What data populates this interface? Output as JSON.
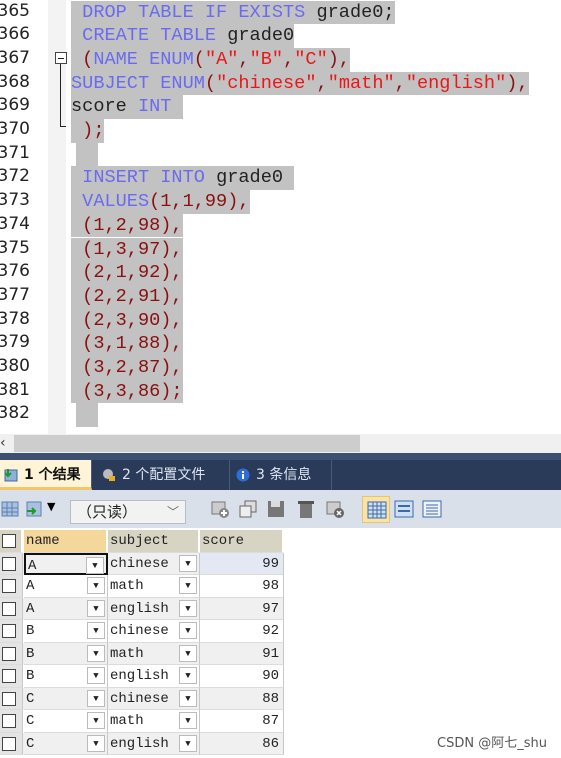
{
  "editor": {
    "line_numbers": [
      "365",
      "366",
      "367",
      "368",
      "369",
      "370",
      "371",
      "372",
      "373",
      "374",
      "375",
      "376",
      "377",
      "378",
      "379",
      "380",
      "381",
      "382"
    ],
    "lines": [
      [
        {
          "t": " DROP TABLE IF EXISTS ",
          "c": "kw"
        },
        {
          "t": "grade0;",
          "c": "id"
        }
      ],
      [
        {
          "t": " CREATE TABLE ",
          "c": "kw"
        },
        {
          "t": "grade0",
          "c": "id"
        }
      ],
      [
        {
          "t": " (",
          "c": "pu"
        },
        {
          "t": "NAME ENUM",
          "c": "kw"
        },
        {
          "t": "(",
          "c": "pu"
        },
        {
          "t": "\"A\"",
          "c": "st"
        },
        {
          "t": ",",
          "c": "pu"
        },
        {
          "t": "\"B\"",
          "c": "st"
        },
        {
          "t": ",",
          "c": "pu"
        },
        {
          "t": "\"C\"",
          "c": "st"
        },
        {
          "t": "),",
          "c": "pu"
        }
      ],
      [
        {
          "t": "SUBJECT ENUM",
          "c": "kw"
        },
        {
          "t": "(",
          "c": "pu"
        },
        {
          "t": "\"chinese\"",
          "c": "st"
        },
        {
          "t": ",",
          "c": "pu"
        },
        {
          "t": "\"math\"",
          "c": "st"
        },
        {
          "t": ",",
          "c": "pu"
        },
        {
          "t": "\"english\"",
          "c": "st"
        },
        {
          "t": "),",
          "c": "pu"
        }
      ],
      [
        {
          "t": "score ",
          "c": "id"
        },
        {
          "t": "INT ",
          "c": "kw"
        }
      ],
      [
        {
          "t": " );",
          "c": "pu"
        }
      ],
      [
        {
          "t": "  ",
          "c": "id"
        }
      ],
      [
        {
          "t": " INSERT INTO ",
          "c": "kw"
        },
        {
          "t": "grade0 ",
          "c": "id"
        }
      ],
      [
        {
          "t": " VALUES",
          "c": "kw"
        },
        {
          "t": "(1,1,99),",
          "c": "pu"
        }
      ],
      [
        {
          "t": " (1,2,98),",
          "c": "pu"
        }
      ],
      [
        {
          "t": " (1,3,97),",
          "c": "pu"
        }
      ],
      [
        {
          "t": " (2,1,92),",
          "c": "pu"
        }
      ],
      [
        {
          "t": " (2,2,91),",
          "c": "pu"
        }
      ],
      [
        {
          "t": " (2,3,90),",
          "c": "pu"
        }
      ],
      [
        {
          "t": " (3,1,88),",
          "c": "pu"
        }
      ],
      [
        {
          "t": " (3,2,87),",
          "c": "pu"
        }
      ],
      [
        {
          "t": " (3,3,86);",
          "c": "pu"
        }
      ],
      [
        {
          "t": "  ",
          "c": "id"
        }
      ]
    ]
  },
  "results": {
    "tabs": [
      {
        "label": "1 个结果",
        "icon": "result-grid-icon",
        "active": true
      },
      {
        "label": "2 个配置文件",
        "icon": "profile-icon",
        "active": false
      },
      {
        "label": "3 条信息",
        "icon": "info-icon",
        "active": false
      }
    ],
    "toolbar": {
      "readonly_select": "（只读）",
      "icons": [
        "export-icon",
        "import-icon",
        "add-row-icon",
        "duplicate-row-icon",
        "save-icon",
        "delete-icon",
        "cancel-icon",
        "grid-view-icon",
        "form-view-icon",
        "text-view-icon"
      ]
    },
    "columns": [
      "name",
      "subject",
      "score"
    ],
    "rows": [
      [
        "A",
        "chinese",
        "99"
      ],
      [
        "A",
        "math",
        "98"
      ],
      [
        "A",
        "english",
        "97"
      ],
      [
        "B",
        "chinese",
        "92"
      ],
      [
        "B",
        "math",
        "91"
      ],
      [
        "B",
        "english",
        "90"
      ],
      [
        "C",
        "chinese",
        "88"
      ],
      [
        "C",
        "math",
        "87"
      ],
      [
        "C",
        "english",
        "86"
      ]
    ]
  },
  "watermark": "CSDN @阿七_shu",
  "colors": {
    "keyword": "#6b6bf0",
    "string": "#e81818",
    "selection": "#c2c2c2",
    "tabbar": "#2a3b5a"
  }
}
